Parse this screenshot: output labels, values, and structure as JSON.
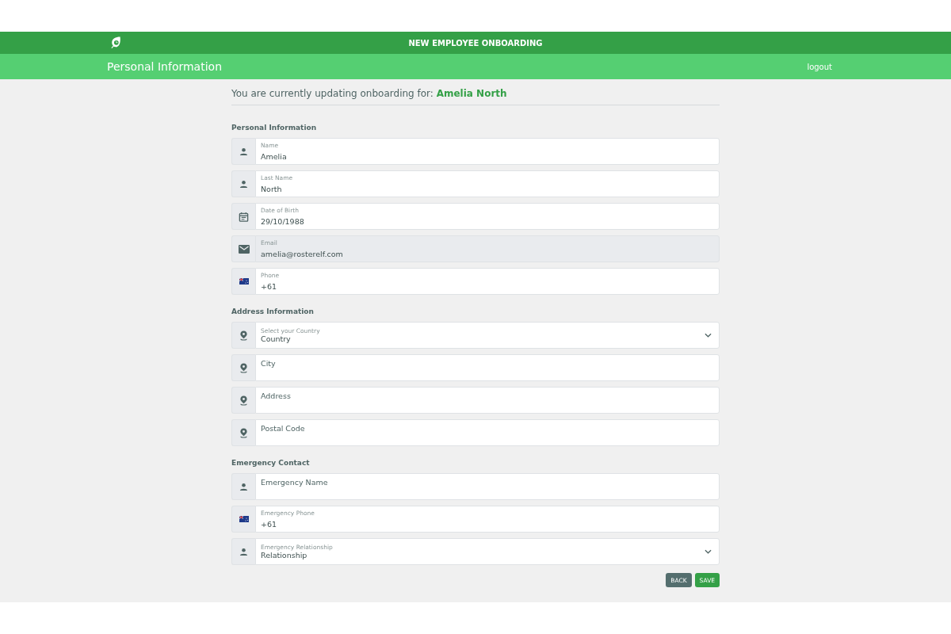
{
  "header": {
    "title": "NEW EMPLOYEE ONBOARDING"
  },
  "subheader": {
    "title": "Personal Information",
    "logout": "logout"
  },
  "intro": {
    "text": "You are currently updating onboarding for:",
    "name": "Amelia North"
  },
  "sections": [
    {
      "title": "Personal Information",
      "fields": [
        {
          "kind": "text",
          "label": "Name",
          "value": "Amelia",
          "disabled": false
        },
        {
          "kind": "text",
          "label": "Last Name",
          "value": "North",
          "disabled": false
        },
        {
          "kind": "text",
          "label": "Date of Birth",
          "value": "29/10/1988",
          "disabled": false
        },
        {
          "kind": "text",
          "label": "Email",
          "value": "amelia@rosterelf.com",
          "disabled": true
        },
        {
          "kind": "text",
          "label": "Phone",
          "value": "+61",
          "disabled": false
        }
      ]
    },
    {
      "title": "Address Information",
      "fields": [
        {
          "kind": "select",
          "label": "Select your Country",
          "value": "Country",
          "disabled": false
        },
        {
          "kind": "text",
          "placeholder": "City",
          "disabled": false
        },
        {
          "kind": "text",
          "placeholder": "Address",
          "disabled": false
        },
        {
          "kind": "text",
          "placeholder": "Postal Code",
          "disabled": false
        }
      ]
    },
    {
      "title": "Emergency Contact",
      "fields": [
        {
          "kind": "text",
          "placeholder": "Emergency Name",
          "disabled": false
        },
        {
          "kind": "text",
          "label": "Emergency Phone",
          "value": "+61",
          "disabled": false
        },
        {
          "kind": "select",
          "label": "Emergency Relationship",
          "value": "Relationship",
          "disabled": false
        }
      ]
    }
  ],
  "buttons": [
    {
      "kind": "back",
      "label": "BACK"
    },
    {
      "kind": "save",
      "label": "SAVE"
    }
  ]
}
